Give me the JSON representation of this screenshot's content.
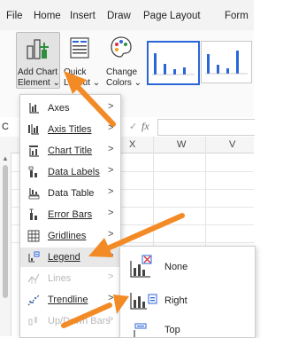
{
  "menu_tabs": [
    "File",
    "Home",
    "Insert",
    "Draw",
    "Page Layout",
    "Form"
  ],
  "ribbon": {
    "add_chart_element": {
      "line1": "Add Chart",
      "line2": "Element ⌄"
    },
    "quick_layout": {
      "line1": "Quick",
      "line2": "Layout ⌄"
    },
    "change_colors": {
      "line1": "Change",
      "line2": "Colors ⌄"
    }
  },
  "formula_bar": {
    "fx": "fx",
    "check": "✓",
    "name_box_partial": "C"
  },
  "columns": [
    "X",
    "W",
    "V"
  ],
  "add_chart_menu": [
    {
      "label": "Axes",
      "icon": "axes-icon",
      "submenu": true,
      "disabled": false
    },
    {
      "label": "Axis Titles",
      "icon": "axis-titles-icon",
      "submenu": true,
      "disabled": false
    },
    {
      "label": "Chart Title",
      "icon": "chart-title-icon",
      "submenu": true,
      "disabled": false
    },
    {
      "label": "Data Labels",
      "icon": "data-labels-icon",
      "submenu": true,
      "disabled": false
    },
    {
      "label": "Data Table",
      "icon": "data-table-icon",
      "submenu": true,
      "disabled": false
    },
    {
      "label": "Error Bars",
      "icon": "error-bars-icon",
      "submenu": true,
      "disabled": false
    },
    {
      "label": "Gridlines",
      "icon": "gridlines-icon",
      "submenu": true,
      "disabled": false
    },
    {
      "label": "Legend",
      "icon": "legend-icon",
      "submenu": true,
      "disabled": false,
      "highlighted": true
    },
    {
      "label": "Lines",
      "icon": "lines-icon",
      "submenu": true,
      "disabled": true
    },
    {
      "label": "Trendline",
      "icon": "trendline-icon",
      "submenu": true,
      "disabled": false
    },
    {
      "label": "Up/Down Bars",
      "icon": "up-down-bars-icon",
      "submenu": true,
      "disabled": true
    }
  ],
  "legend_submenu": [
    {
      "label": "None",
      "icon": "legend-none-icon"
    },
    {
      "label": "Right",
      "icon": "legend-right-icon"
    },
    {
      "label": "Top",
      "icon": "legend-top-icon"
    }
  ],
  "colors": {
    "accent": "#2b66d9",
    "arrow": "#f28a25"
  }
}
